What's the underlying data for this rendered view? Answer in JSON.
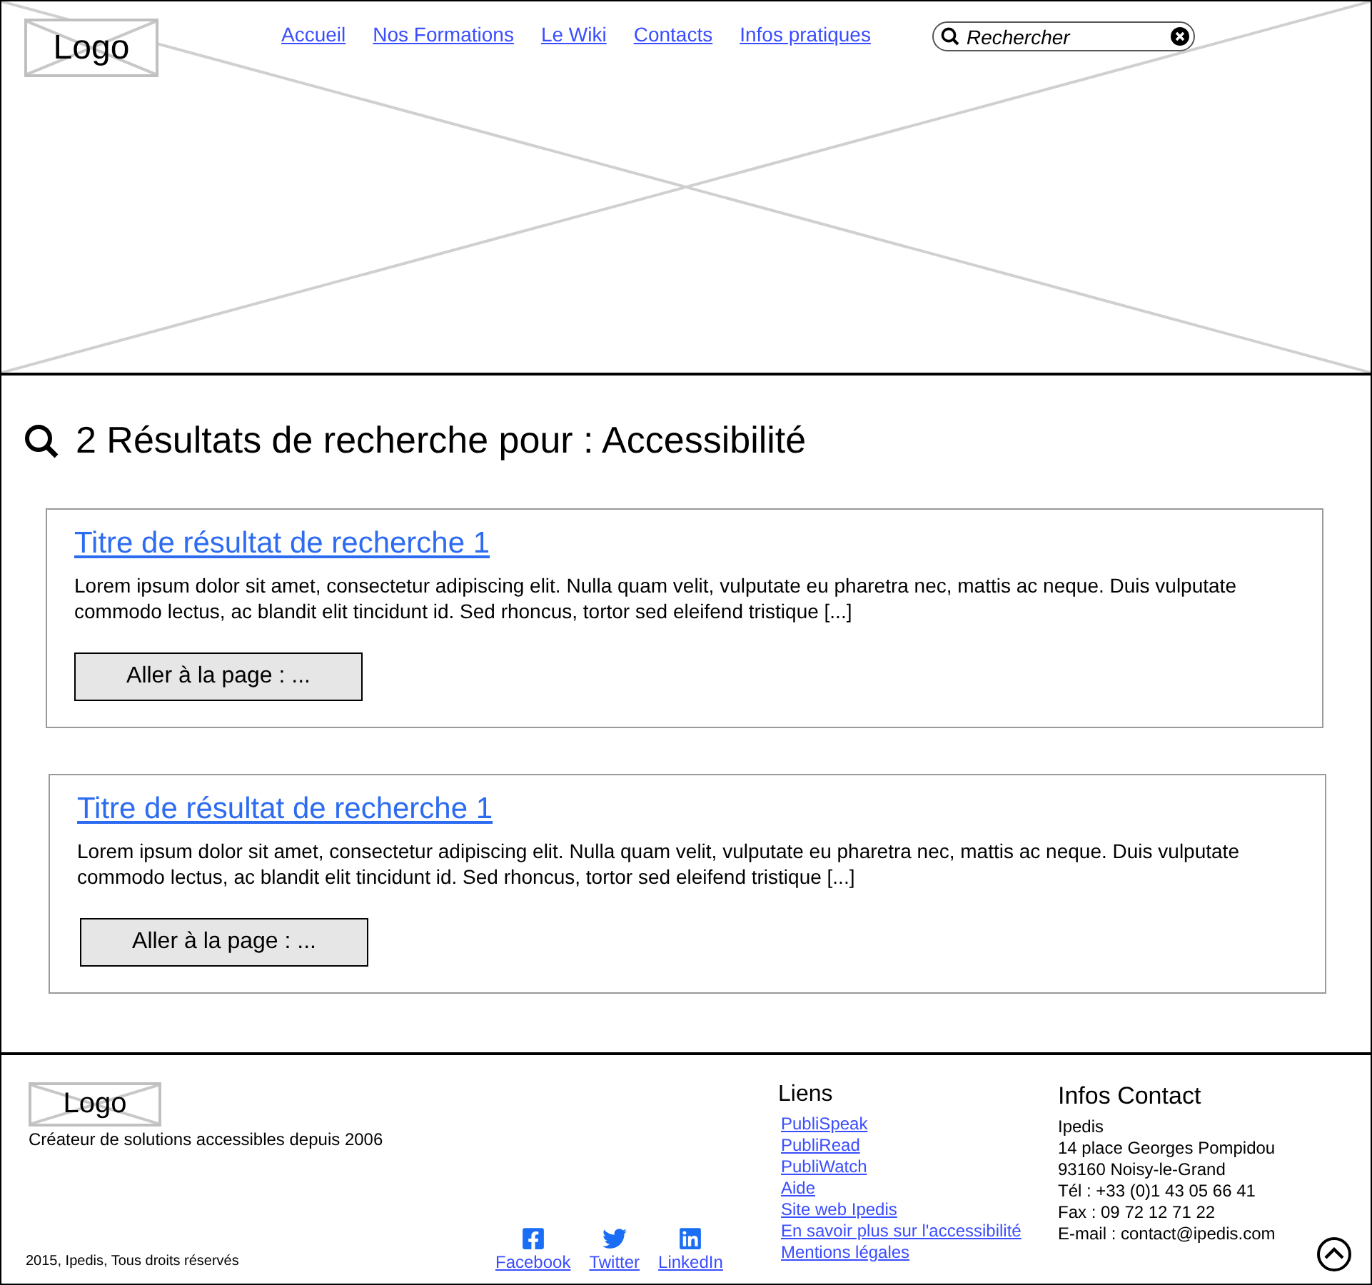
{
  "header": {
    "logo": "Logo",
    "nav": [
      {
        "label": "Accueil"
      },
      {
        "label": "Nos Formations"
      },
      {
        "label": "Le Wiki"
      },
      {
        "label": "Contacts"
      },
      {
        "label": "Infos pratiques"
      }
    ],
    "search": {
      "placeholder": "Rechercher"
    }
  },
  "results": {
    "title": "2 Résultats de recherche pour : Accessibilité",
    "items": [
      {
        "title": "Titre de résultat de recherche 1",
        "excerpt": "Lorem ipsum dolor sit amet, consectetur adipiscing elit. Nulla quam velit, vulputate eu pharetra nec, mattis ac neque. Duis vulputate commodo lectus, ac blandit elit tincidunt id. Sed rhoncus, tortor sed eleifend tristique [...]",
        "button": "Aller à la page : ..."
      },
      {
        "title": "Titre de résultat de recherche 1",
        "excerpt": "Lorem ipsum dolor sit amet, consectetur adipiscing elit. Nulla quam velit, vulputate eu pharetra nec, mattis ac neque. Duis vulputate commodo lectus, ac blandit elit tincidunt id. Sed rhoncus, tortor sed eleifend tristique [...]",
        "button": "Aller à la page : ..."
      }
    ]
  },
  "footer": {
    "logo": "Logo",
    "tagline": "Créateur de solutions accessibles depuis 2006",
    "copyright": "2015, Ipedis, Tous droits réservés",
    "social": [
      {
        "kind": "facebook",
        "label": "Facebook"
      },
      {
        "kind": "twitter",
        "label": "Twitter"
      },
      {
        "kind": "linkedin",
        "label": "LinkedIn"
      }
    ],
    "links": {
      "heading": "Liens",
      "items": [
        "PubliSpeak",
        "PubliRead",
        "PubliWatch",
        "Aide",
        "Site web Ipedis",
        "En savoir plus sur l'accessibilité",
        "Mentions légales"
      ]
    },
    "contact": {
      "heading": "Infos Contact",
      "lines": [
        "Ipedis",
        "14 place Georges Pompidou",
        "93160 Noisy-le-Grand",
        "Tél : +33 (0)1 43 05 66 41",
        "Fax : 09 72 12 71 22",
        "E-mail : contact@ipedis.com"
      ]
    }
  }
}
